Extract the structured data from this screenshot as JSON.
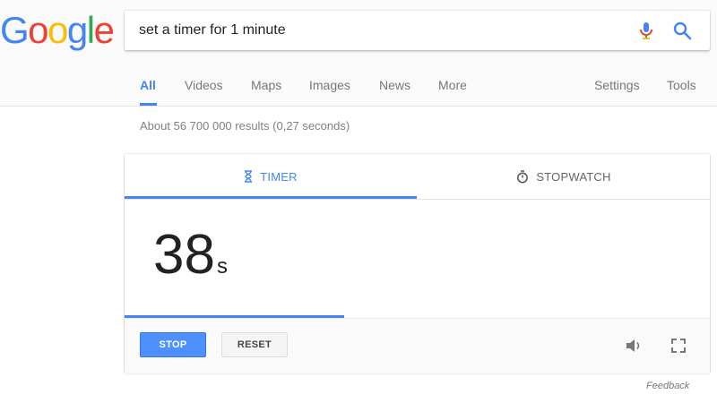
{
  "logo": {
    "letters": [
      "G",
      "o",
      "o",
      "g",
      "l",
      "e"
    ],
    "colors": [
      "#4285F4",
      "#EA4335",
      "#FBBC05",
      "#4285F4",
      "#34A853",
      "#EA4335"
    ]
  },
  "search": {
    "query": "set a timer for 1 minute"
  },
  "nav": {
    "tabs": [
      {
        "label": "All",
        "active": true
      },
      {
        "label": "Videos",
        "active": false
      },
      {
        "label": "Maps",
        "active": false
      },
      {
        "label": "Images",
        "active": false
      },
      {
        "label": "News",
        "active": false
      },
      {
        "label": "More",
        "active": false
      }
    ],
    "settings_label": "Settings",
    "tools_label": "Tools"
  },
  "results": {
    "stats": "About 56 700 000 results (0,27 seconds)"
  },
  "timer_card": {
    "tabs": {
      "timer_label": "TIMER",
      "timer_icon": "hourglass-icon",
      "stopwatch_label": "STOPWATCH",
      "stopwatch_icon": "stopwatch-icon"
    },
    "active_tab": "timer",
    "display_value": "38",
    "display_unit": "s",
    "progress_fraction": 0.375,
    "buttons": {
      "stop_label": "STOP",
      "reset_label": "RESET"
    },
    "icons": [
      "volume-icon",
      "fullscreen-icon"
    ]
  },
  "footer": {
    "feedback_label": "Feedback"
  },
  "colors": {
    "accent": "#4285F4",
    "stop_button": "#4D90FE"
  }
}
